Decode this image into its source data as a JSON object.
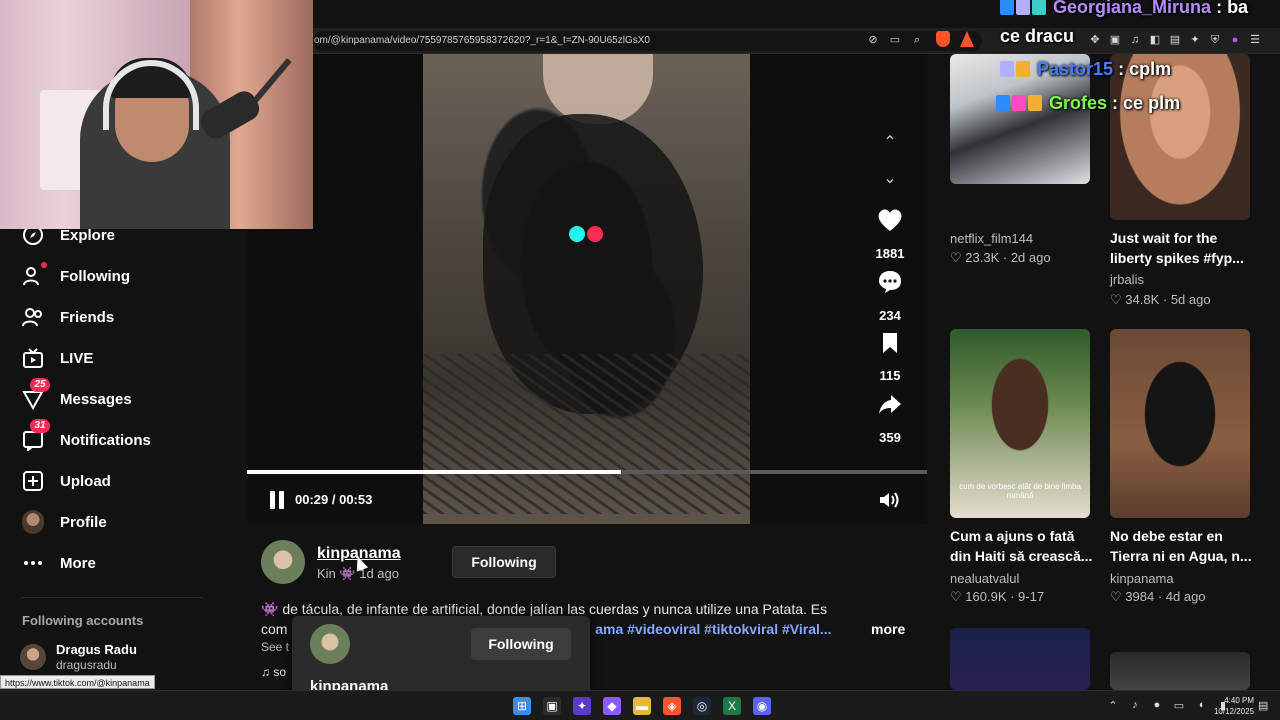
{
  "browser": {
    "url": "om/@kinpanama/video/7559785765958372620?_r=1&_t=ZN-90U65zlGsX0",
    "status_url": "https://www.tiktok.com/@kinpanama"
  },
  "sidebar": {
    "items": [
      {
        "label": "Explore",
        "icon": "compass-icon"
      },
      {
        "label": "Following",
        "icon": "following-icon"
      },
      {
        "label": "Friends",
        "icon": "friends-icon"
      },
      {
        "label": "LIVE",
        "icon": "live-icon"
      },
      {
        "label": "Messages",
        "icon": "messages-icon",
        "badge": "25"
      },
      {
        "label": "Notifications",
        "icon": "notifications-icon",
        "badge": "31"
      },
      {
        "label": "Upload",
        "icon": "upload-icon"
      },
      {
        "label": "Profile",
        "icon": "profile-avatar"
      },
      {
        "label": "More",
        "icon": "more-icon"
      }
    ],
    "following_heading": "Following accounts",
    "accounts": [
      {
        "name": "Dragus Radu",
        "username": "dragusradu"
      }
    ]
  },
  "video": {
    "progress": 0.55,
    "time": "00:29 / 00:53",
    "likes": "1881",
    "comments": "234",
    "bookmarks": "115",
    "shares": "359"
  },
  "author": {
    "name": "kinpanama",
    "nickname": "Kin",
    "time_ago": "1d ago",
    "follow_label": "Following"
  },
  "description": {
    "line1": "de tácula, de infante de artificial, donde jalían las cuerdas y nunca utilize una Patata. Es",
    "line2_prefix": "com",
    "line2_tags": "ama #videoviral #tiktokviral #Viral...",
    "more": "more",
    "see": "See t",
    "sound": "♫ so"
  },
  "hover_card": {
    "follow_label": "Following",
    "name": "kinpanama"
  },
  "recommended": [
    {
      "caption": "",
      "user": "netflix_film144",
      "likes": "23.3K",
      "time": "2d ago"
    },
    {
      "caption": "Just wait for the liberty spikes #fyp...",
      "user": "jrbalis",
      "likes": "34.8K",
      "time": "5d ago"
    },
    {
      "caption": "Cum a ajuns o fată din Haiti să crească...",
      "user": "nealuatvalul",
      "likes": "160.9K",
      "time": "9-17",
      "thumb_text": "cum de vorbesc atât de bine limba română"
    },
    {
      "caption": "No debe estar en Tierra ni en Agua, n...",
      "user": "kinpanama",
      "likes": "3984",
      "time": "4d ago"
    }
  ],
  "chat": [
    {
      "user": "Georgiana_Miruna",
      "message": "ba",
      "user_color": "#b58cff"
    },
    {
      "user": "",
      "message": "ce dracu",
      "user_color": "#ffffff"
    },
    {
      "user": "Pastor15",
      "message": "cplm",
      "user_color": "#4a7dff"
    },
    {
      "user": "Grofes",
      "message": "ce plm",
      "user_color": "#7dff4a"
    }
  ],
  "taskbar": {
    "time": "4:40 PM",
    "date": "10/12/2025"
  },
  "colors": {
    "accent": "#fe2c55",
    "background": "#121212",
    "hashtag": "#86a8ff"
  }
}
